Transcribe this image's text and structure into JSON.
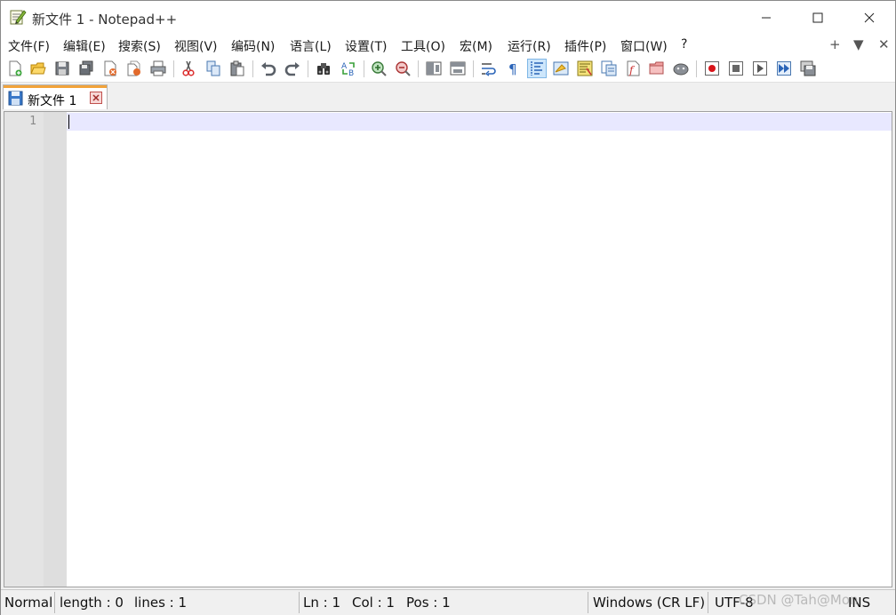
{
  "window": {
    "title": "新文件 1 - Notepad++",
    "min_icon": "minimize-icon",
    "max_icon": "maximize-icon",
    "close_icon": "close-icon"
  },
  "menu": {
    "items": [
      "文件(F)",
      "编辑(E)",
      "搜索(S)",
      "视图(V)",
      "编码(N)",
      "语言(L)",
      "设置(T)",
      "工具(O)",
      "宏(M)",
      "运行(R)",
      "插件(P)",
      "窗口(W)",
      "?"
    ],
    "right": [
      "+",
      "▼",
      "✕"
    ]
  },
  "toolbar": {
    "icons": [
      "new-file-icon",
      "open-file-icon",
      "save-icon",
      "save-all-icon",
      "close-icon",
      "close-all-icon",
      "print-icon",
      "cut-icon",
      "copy-icon",
      "paste-icon",
      "undo-icon",
      "redo-icon",
      "find-icon",
      "replace-icon",
      "zoom-in-icon",
      "zoom-out-icon",
      "sync-vertical-icon",
      "sync-horizontal-icon",
      "word-wrap-icon",
      "show-all-characters-icon",
      "indent-guide-icon",
      "udl-icon",
      "document-map-icon",
      "document-list-icon",
      "function-list-icon",
      "folder-workspace-icon",
      "monitoring-icon",
      "record-macro-icon",
      "stop-recording-icon",
      "play-macro-icon",
      "run-macro-multiple-icon",
      "save-macro-icon"
    ],
    "active": "indent-guide-icon"
  },
  "tabs": [
    {
      "label": "新文件 1",
      "icon": "unsaved-file-icon",
      "close_icon": "tab-close-icon",
      "accent": "#f2a33a"
    }
  ],
  "editor": {
    "line_numbers": [
      "1"
    ],
    "current_line_color": "#e8e8ff"
  },
  "status": {
    "mode": "Normal",
    "length": "length : 0",
    "lines": "lines : 1",
    "ln": "Ln : 1",
    "col": "Col : 1",
    "pos": "Pos : 1",
    "eol": "Windows (CR LF)",
    "encoding": "UTF-8",
    "ins": "INS",
    "watermark": "CSDN @Tah@Mon"
  }
}
